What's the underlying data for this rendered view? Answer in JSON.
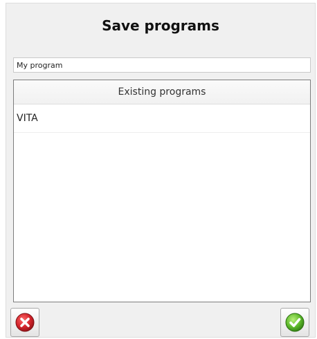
{
  "dialog": {
    "title": "Save programs",
    "name_input": {
      "value": "My program",
      "placeholder": ""
    },
    "list": {
      "header": "Existing programs",
      "items": [
        {
          "label": "VITA"
        }
      ]
    },
    "buttons": {
      "cancel_icon": "red-x-icon",
      "ok_icon": "green-check-icon"
    },
    "colors": {
      "cancel": "#d2232a",
      "ok": "#5cb82a"
    }
  }
}
